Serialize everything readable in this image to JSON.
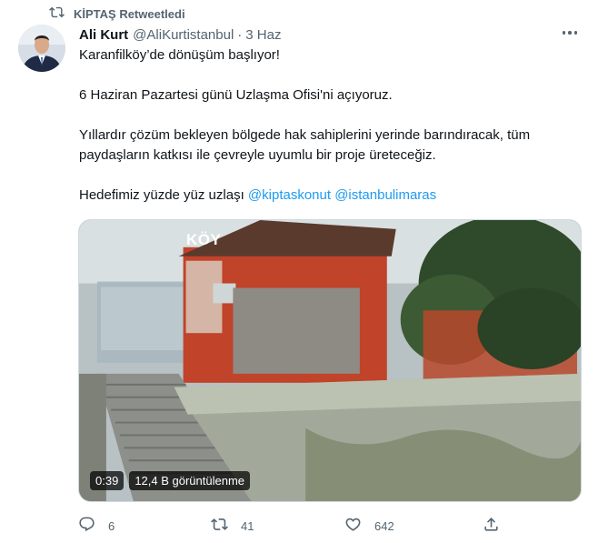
{
  "retweet": {
    "label": "KİPTAŞ Retweetledi"
  },
  "author": {
    "name": "Ali Kurt",
    "handle": "@AliKurtistanbul",
    "separator": "·",
    "date": "3 Haz"
  },
  "tweet": {
    "line1": "Karanfilköy’de dönüşüm başlıyor!",
    "line2": "6 Haziran Pazartesi günü Uzlaşma Ofisi'ni açıyoruz.",
    "line3": "Yıllardır çözüm bekleyen bölgede hak sahiplerini yerinde barındıracak, tüm paydaşların katkısı ile çevreyle uyumlu bir proje üreteceğiz.",
    "line4_text": "Hedefimiz yüzde yüz uzlaşı ",
    "mention1": "@kiptaskonut",
    "mention2": "@istanbulimaras"
  },
  "media": {
    "overlay_text": "KÖY",
    "duration": "0:39",
    "views": "12,4 B görüntülenme"
  },
  "actions": {
    "reply_count": "6",
    "retweet_count": "41",
    "like_count": "642"
  },
  "icons": [
    "retweet-icon",
    "more-icon",
    "reply-icon",
    "like-icon",
    "share-icon"
  ],
  "colors": {
    "accent": "#1d9bf0",
    "muted": "#536471",
    "text": "#0f1419"
  }
}
